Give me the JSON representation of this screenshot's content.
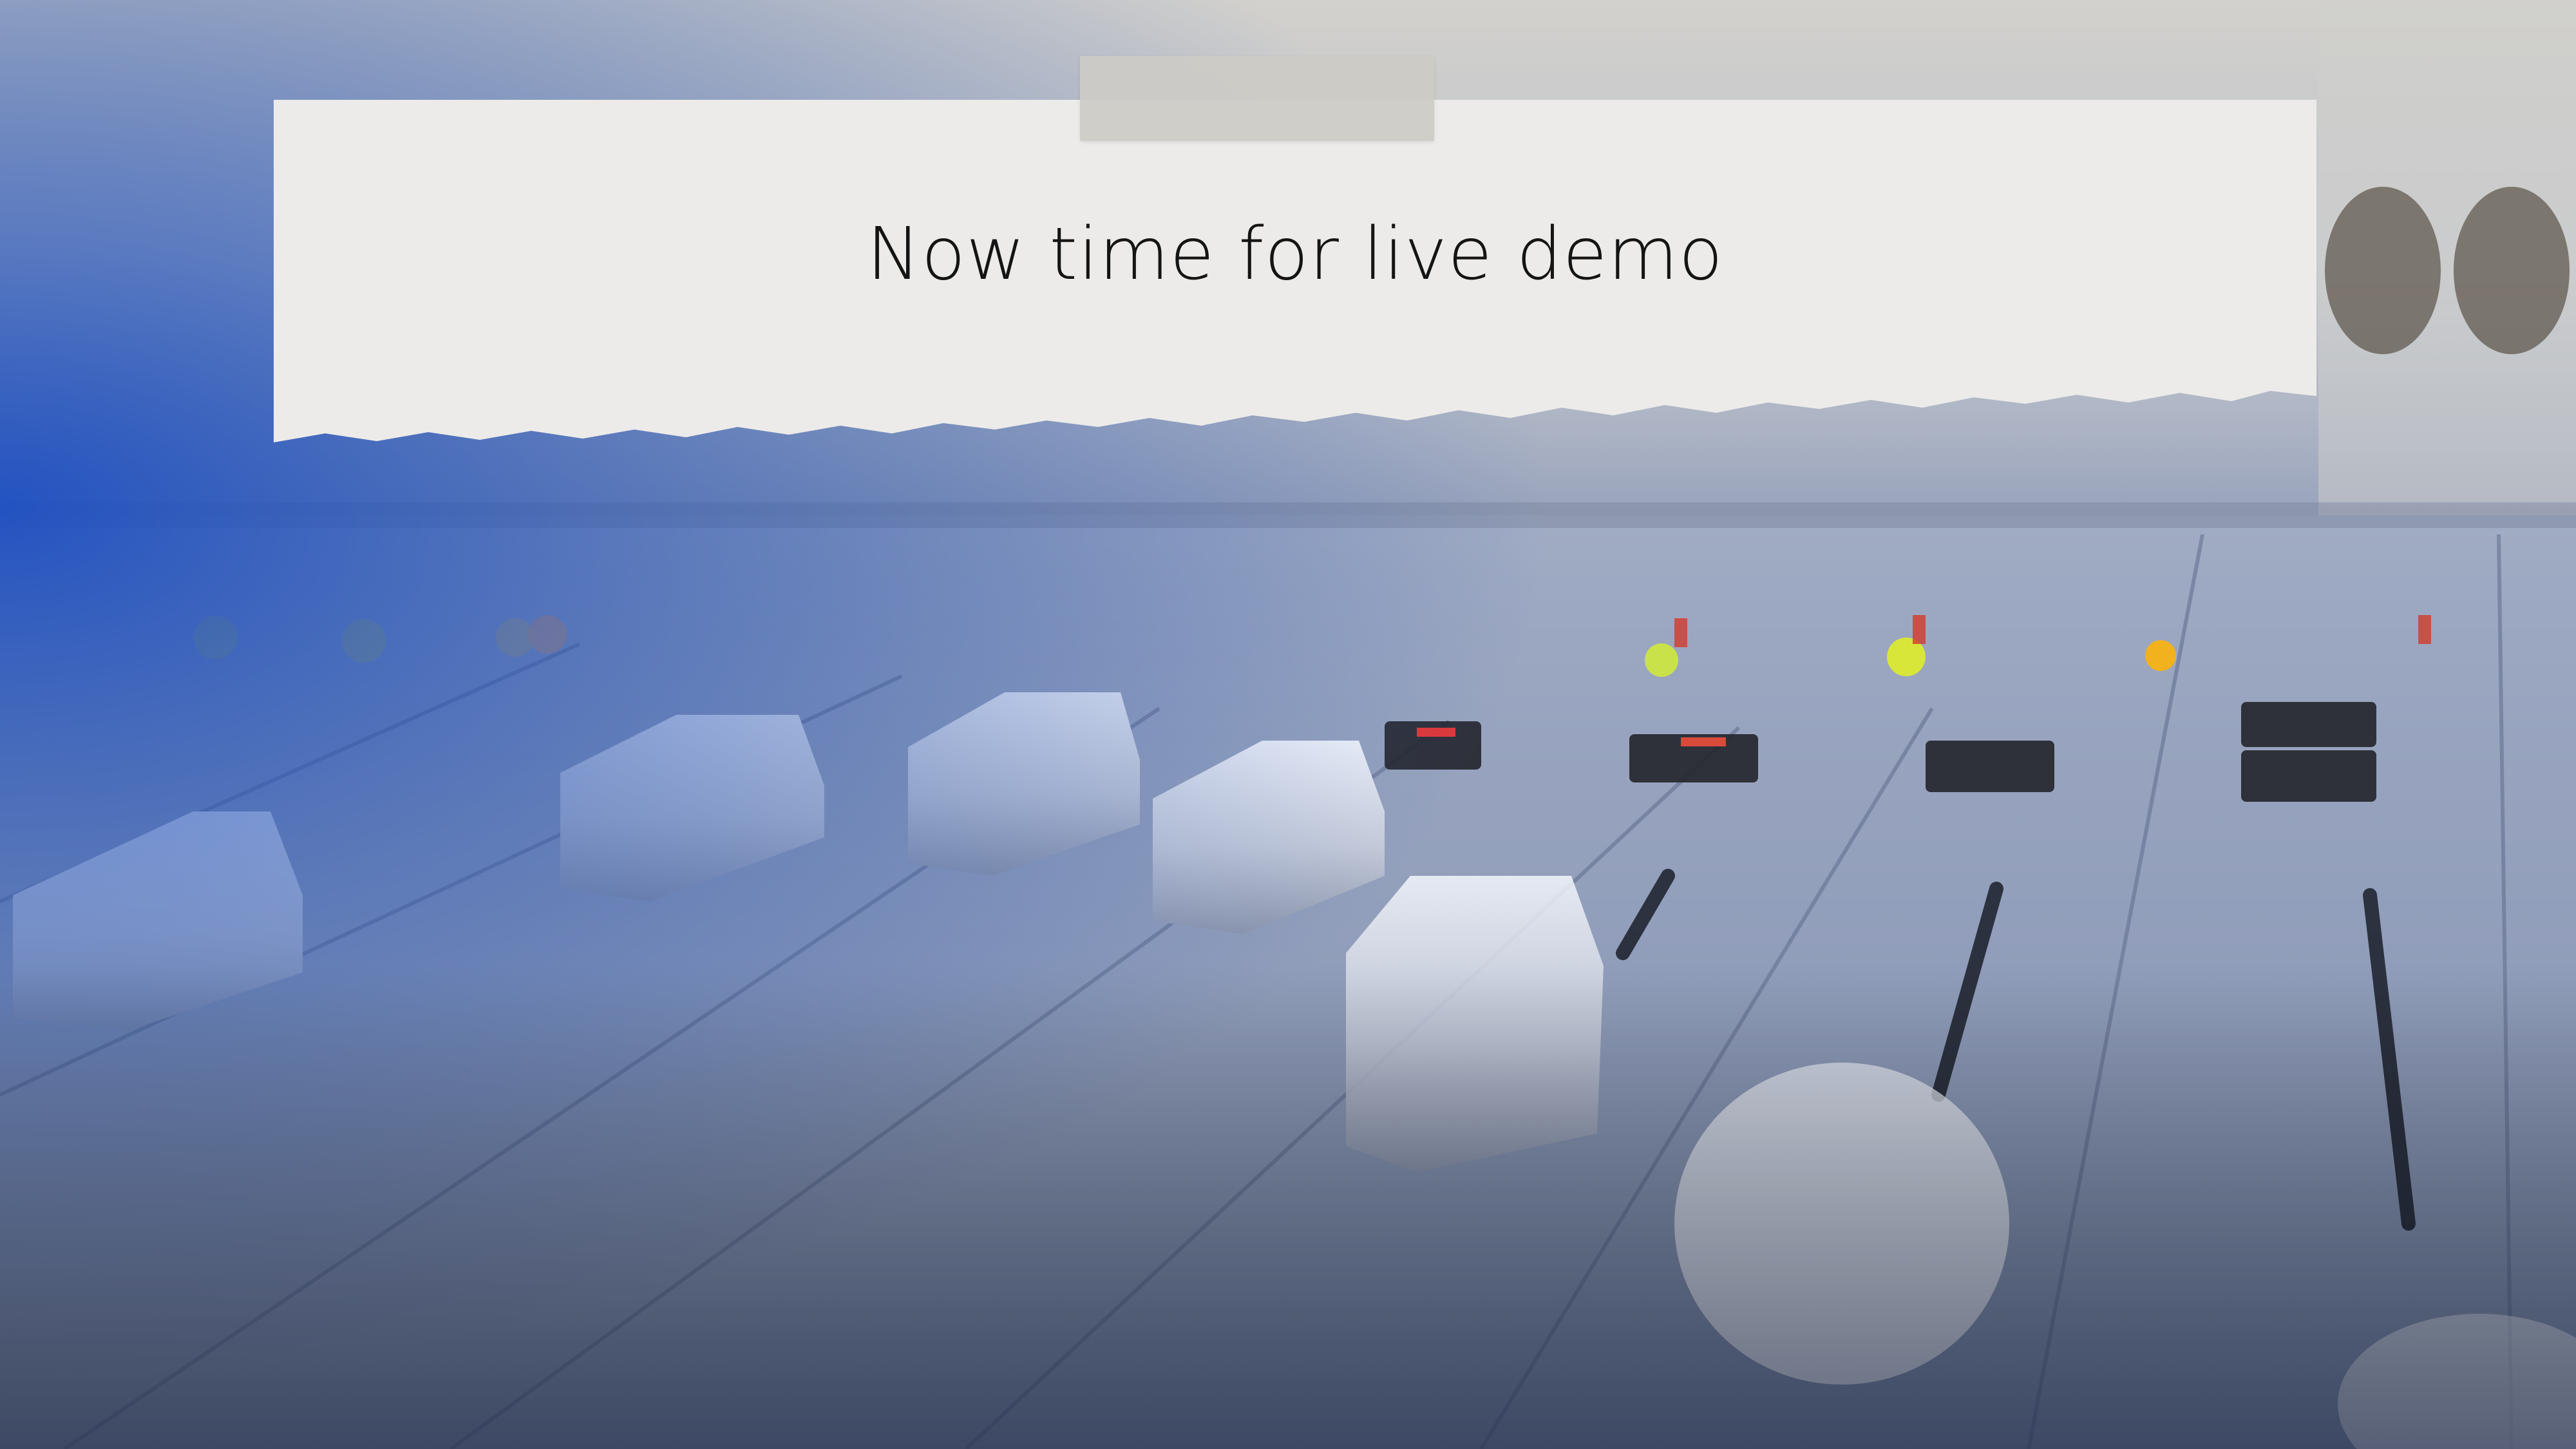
{
  "slide": {
    "title": "Now time for live demo"
  },
  "background": {
    "description_icon": "audio-mixer-photo",
    "accent_color": "#1f4fb8",
    "paper_color": "#ecebe9",
    "tape_color": "#cdcbc6"
  }
}
